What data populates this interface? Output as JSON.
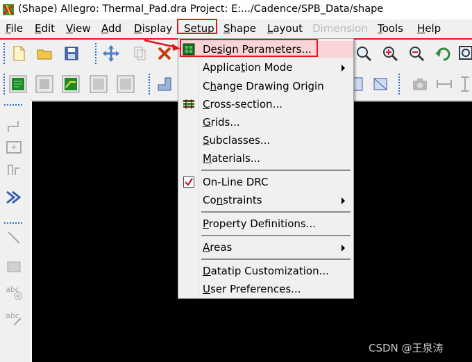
{
  "titlebar": {
    "title": "(Shape) Allegro: Thermal_Pad.dra  Project: E:.../Cadence/SPB_Data/shape"
  },
  "menubar": {
    "items": [
      {
        "label": "File",
        "key": "F",
        "rest": "ile"
      },
      {
        "label": "Edit",
        "key": "E",
        "rest": "dit"
      },
      {
        "label": "View",
        "key": "V",
        "rest": "iew"
      },
      {
        "label": "Add",
        "key": "A",
        "rest": "dd"
      },
      {
        "label": "Display",
        "key": "D",
        "rest": "isplay"
      },
      {
        "label": "Setup",
        "key": "S",
        "rest": "etup"
      },
      {
        "label": "Shape",
        "key": "S",
        "rest": "hape"
      },
      {
        "label": "Layout",
        "key": "L",
        "rest": "ayout"
      },
      {
        "label": "Dimension",
        "key": "",
        "rest": "Dimension"
      },
      {
        "label": "Tools",
        "key": "T",
        "rest": "ools"
      },
      {
        "label": "Help",
        "key": "H",
        "rest": "elp"
      }
    ]
  },
  "setup_menu": {
    "items": [
      {
        "pre": "De",
        "key": "s",
        "post": "ign Parameters...",
        "icon": "design-parameters-icon"
      },
      {
        "pre": "Applica",
        "key": "t",
        "post": "ion Mode"
      },
      {
        "pre": "C",
        "key": "h",
        "post": "ange Drawing Origin"
      },
      {
        "pre": "",
        "key": "C",
        "post": "ross-section...",
        "icon": "cross-section-icon"
      },
      {
        "pre": "",
        "key": "G",
        "post": "rids..."
      },
      {
        "pre": "",
        "key": "S",
        "post": "ubclasses..."
      },
      {
        "pre": "",
        "key": "M",
        "post": "aterials..."
      },
      {
        "pre": "On-Line DRC",
        "key": "",
        "post": "",
        "checked": true
      },
      {
        "pre": "Co",
        "key": "n",
        "post": "straints"
      },
      {
        "pre": "",
        "key": "P",
        "post": "roperty Definitions..."
      },
      {
        "pre": "",
        "key": "A",
        "post": "reas"
      },
      {
        "pre": "",
        "key": "D",
        "post": "atatip Customization..."
      },
      {
        "pre": "",
        "key": "U",
        "post": "ser Preferences..."
      }
    ]
  },
  "watermark": "CSDN @王泉涛",
  "colors": {
    "highlight_red": "#e0161e",
    "menu_bg": "#f0f0f0",
    "canvas": "#000000",
    "hover_bg": "#f9d3d5"
  }
}
